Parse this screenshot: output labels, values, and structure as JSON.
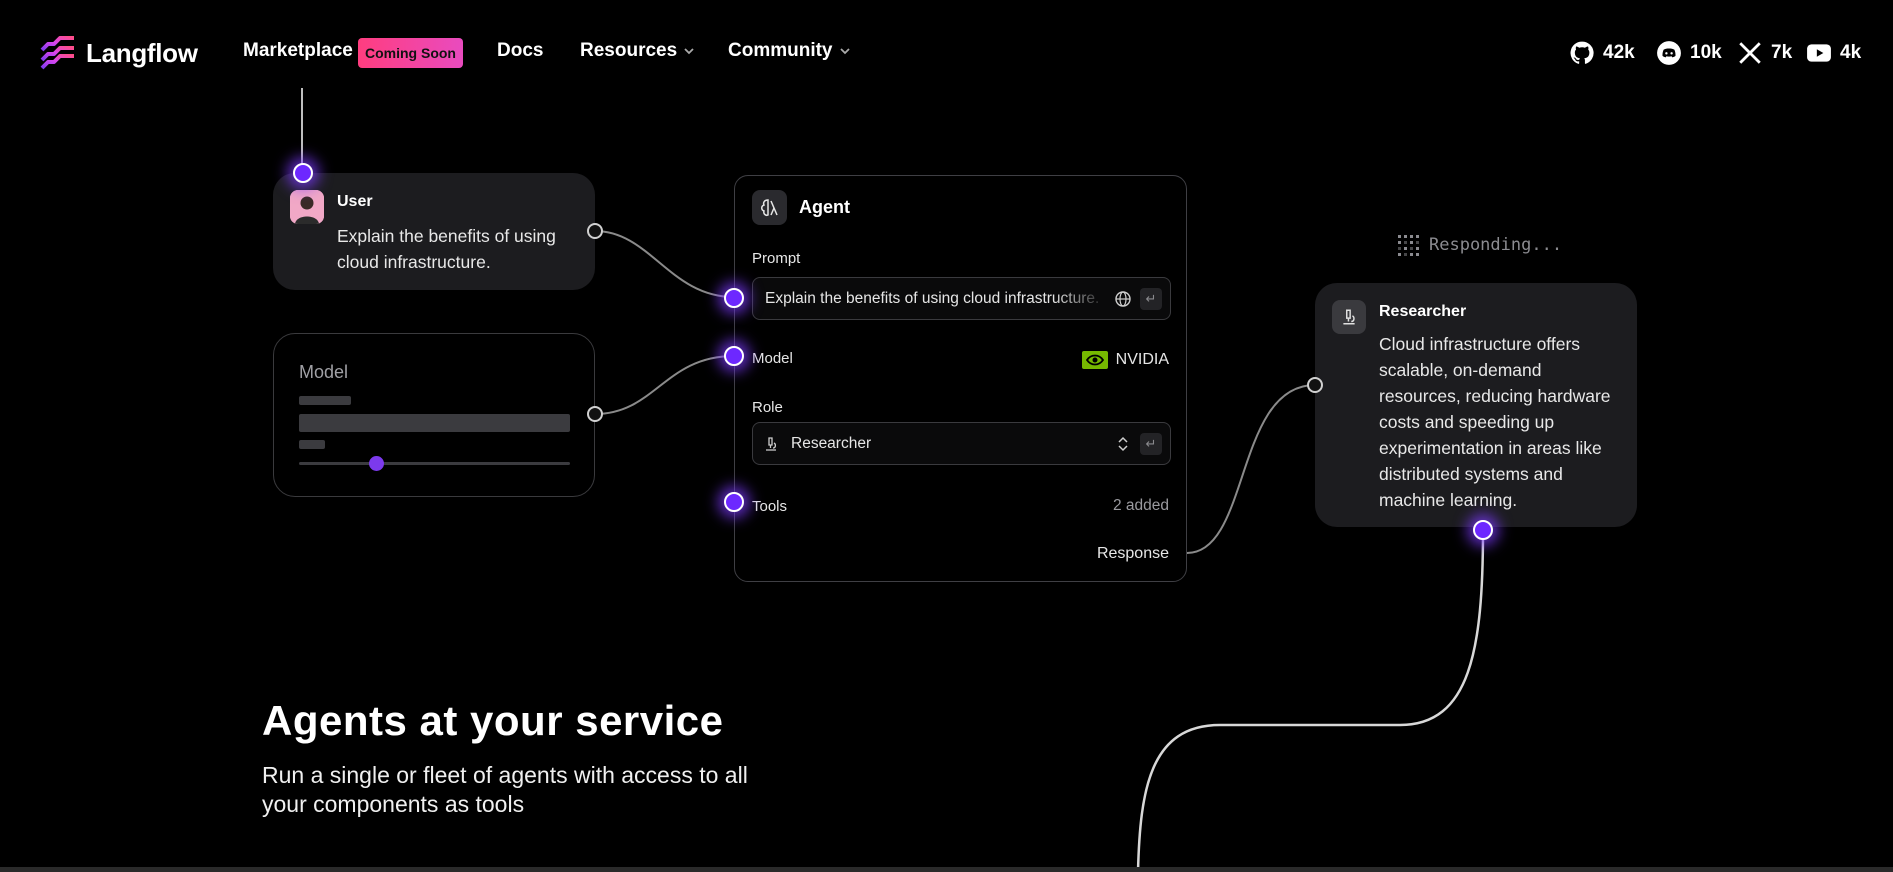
{
  "brand": {
    "name": "Langflow"
  },
  "nav": {
    "marketplace": "Marketplace",
    "coming_soon": "Coming Soon",
    "docs": "Docs",
    "resources": "Resources",
    "community": "Community"
  },
  "socials": [
    {
      "icon": "github-icon",
      "count": "42k"
    },
    {
      "icon": "discord-icon",
      "count": "10k"
    },
    {
      "icon": "x-icon",
      "count": "7k"
    },
    {
      "icon": "youtube-icon",
      "count": "4k"
    }
  ],
  "user_card": {
    "name": "User",
    "message": "Explain the benefits of using cloud infrastructure."
  },
  "model_card": {
    "title": "Model"
  },
  "agent_card": {
    "title": "Agent",
    "prompt_label": "Prompt",
    "prompt_value": "Explain the benefits of using cloud infrastructure.",
    "model_label": "Model",
    "model_value": "NVIDIA",
    "role_label": "Role",
    "role_value": "Researcher",
    "tools_label": "Tools",
    "tools_value": "2 added",
    "response_label": "Response"
  },
  "status": {
    "responding": "Responding..."
  },
  "researcher_card": {
    "name": "Researcher",
    "message": "Cloud infrastructure offers scalable, on-demand resources, reducing hardware costs and speeding up experimentation in areas like distributed systems and machine learning."
  },
  "hero": {
    "title": "Agents at your service",
    "subtitle": "Run a single or fleet of agents with access to all your components as tools"
  },
  "colors": {
    "background": "#000000",
    "card": "#1c1c1f",
    "accent": "#7c3aed",
    "badge": "#ff3d7f",
    "nvidia_green": "#76b900"
  }
}
